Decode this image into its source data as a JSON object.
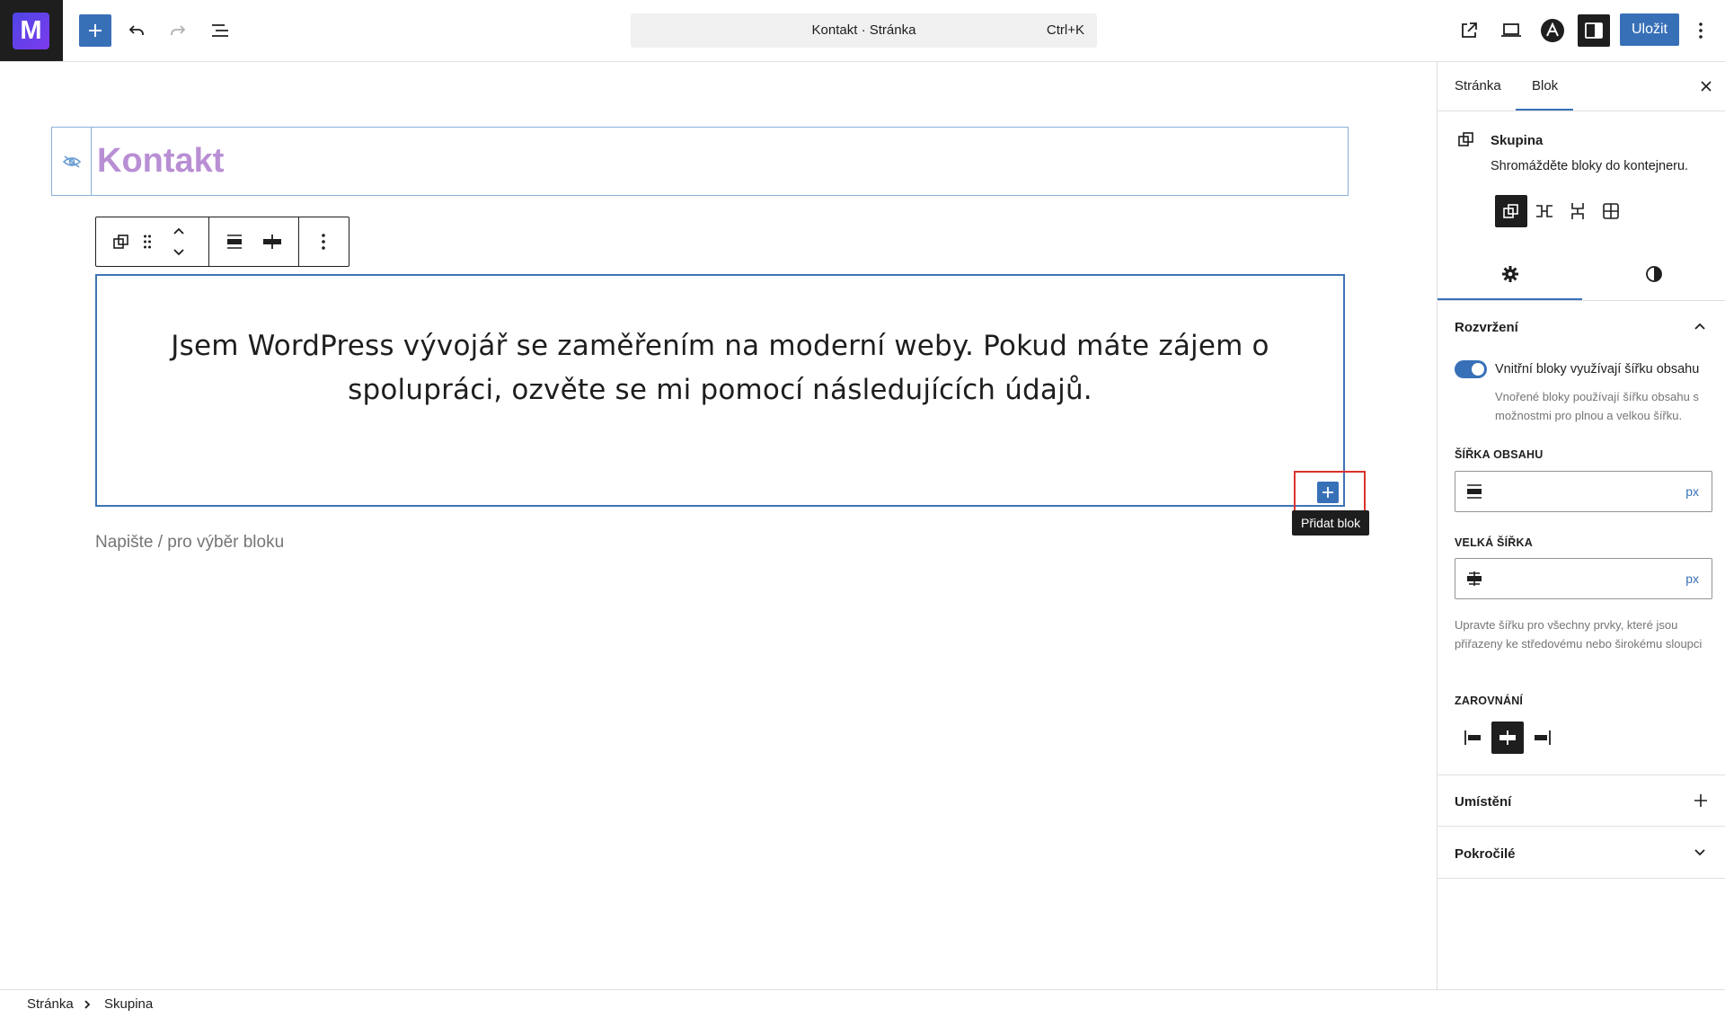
{
  "topbar": {
    "logo_letter": "M",
    "command_title": "Kontakt · Stránka",
    "command_shortcut": "Ctrl+K",
    "save_label": "Uložit",
    "icons": [
      "plus-icon",
      "undo-icon",
      "redo-icon",
      "list-view-icon",
      "external-link-icon",
      "desktop-preview-icon",
      "astra-icon",
      "sidebar-toggle-icon",
      "more-vertical-icon"
    ]
  },
  "editor": {
    "page_title": "Kontakt",
    "paragraph": "Jsem WordPress vývojář se zaměřením na moderní weby. Pokud máte zájem o spolupráci, ozvěte se mi pomocí následujících údajů.",
    "tooltip": "Přidat blok",
    "placeholder": "Napište / pro výběr bloku"
  },
  "sidebar": {
    "tabs": [
      "Stránka",
      "Blok"
    ],
    "active_tab": "Blok",
    "block_name": "Skupina",
    "block_description": "Shromážděte bloky do kontejneru.",
    "layout_section": "Rozvržení",
    "toggle_label": "Vnitřní bloky využívají šířku obsahu",
    "toggle_on": true,
    "toggle_help": "Vnořené bloky používají šířku obsahu s možnostmi pro plnou a velkou šířku.",
    "content_width_label": "ŠÍŘKA OBSAHU",
    "wide_width_label": "VELKÁ ŠÍŘKA",
    "unit": "px",
    "width_help": "Upravte šířku pro všechny prvky, které jsou přiřazeny ke středovému nebo širokému sloupci",
    "alignment_label": "ZAROVNÁNÍ",
    "alignment_selected": "center",
    "position_section": "Umístění",
    "advanced_section": "Pokročilé",
    "accent_color": "#3870b8"
  },
  "footer": {
    "breadcrumb": [
      "Stránka",
      "Skupina"
    ]
  }
}
